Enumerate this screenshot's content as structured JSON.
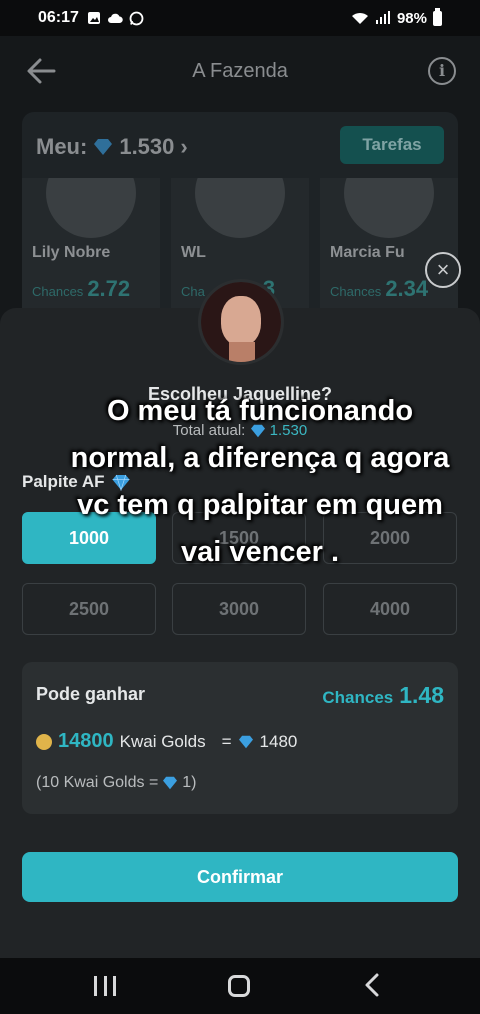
{
  "status_bar": {
    "time": "06:17",
    "battery": "98%",
    "left_icons": [
      "gallery-icon",
      "cloud-icon",
      "whatsapp-icon"
    ],
    "right_icons": [
      "wifi-icon",
      "signal-icon",
      "battery-icon"
    ]
  },
  "header": {
    "title": "A Fazenda"
  },
  "balance": {
    "label": "Meu:",
    "value": "1.530",
    "arrow": "›",
    "tasks_label": "Tarefas"
  },
  "candidates": [
    {
      "name": "Lily Nobre",
      "chances_label": "Chances",
      "chances": "2.72"
    },
    {
      "name": "WL",
      "chances_label": "Cha",
      "chances": "3"
    },
    {
      "name": "Marcia Fu",
      "chances_label": "Chances",
      "chances": "2.34"
    }
  ],
  "close_symbol": "×",
  "sheet": {
    "question": "Escolheu Jaquelline?",
    "total_label": "Total atual:",
    "total_value": "1.530",
    "bet_label": "Palpite AF",
    "options": [
      {
        "label": "1000",
        "selected": true
      },
      {
        "label": "1500",
        "selected": false
      },
      {
        "label": "2000",
        "selected": false
      },
      {
        "label": "2500",
        "selected": false
      },
      {
        "label": "3000",
        "selected": false
      },
      {
        "label": "4000",
        "selected": false
      }
    ],
    "win": {
      "label": "Pode ganhar",
      "chances_label": "Chances",
      "chances_value": "1.48",
      "gold_amount": "14800",
      "gold_unit": "Kwai Golds",
      "equals": "=",
      "diamond_amount": "1480",
      "rate_prefix": "(10 Kwai Golds =",
      "rate_value": "1)"
    },
    "confirm_label": "Confirmar"
  },
  "overlay_text": "O meu tá funcionando normal, a diferença q agora vc tem q palpitar em quem vai vencer .",
  "colors": {
    "accent": "#2fb6c3",
    "diamond": "#3b9fe0",
    "background": "#15181a"
  }
}
